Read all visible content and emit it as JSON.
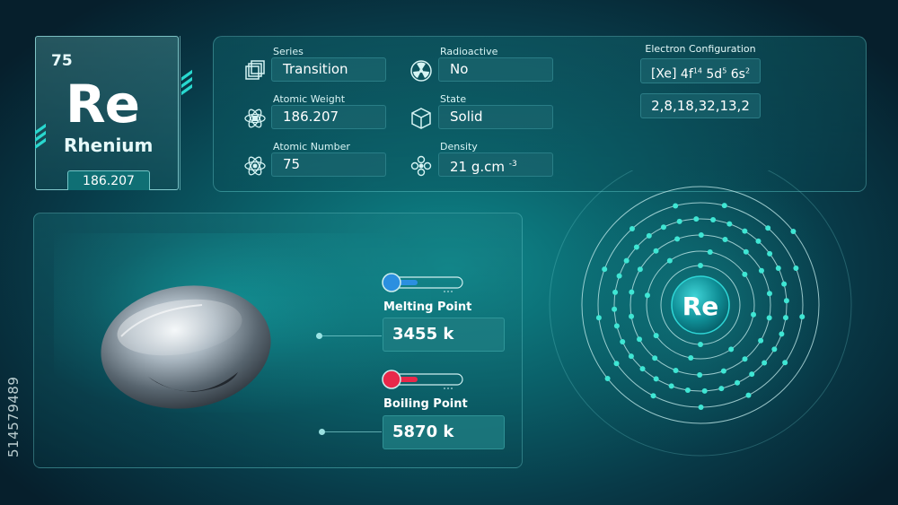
{
  "watermark": "514579489",
  "element": {
    "atomic_number": "75",
    "symbol": "Re",
    "name": "Rhenium",
    "atomic_weight": "186.207"
  },
  "properties": {
    "series_label": "Series",
    "series_value": "Transition",
    "radioactive_label": "Radioactive",
    "radioactive_value": "No",
    "atomic_weight_label": "Atomic Weight",
    "atomic_weight_value": "186.207",
    "state_label": "State",
    "state_value": "Solid",
    "atomic_number_label": "Atomic Number",
    "atomic_number_value": "75",
    "density_label": "Density",
    "density_value": "21 g.cm",
    "density_exp": "-3"
  },
  "electron_configuration": {
    "label": "Electron Configuration",
    "core": "[Xe]",
    "orbitals": [
      {
        "orbital": "4f",
        "count": "14"
      },
      {
        "orbital": "5d",
        "count": "5"
      },
      {
        "orbital": "6s",
        "count": "2"
      }
    ],
    "shells": "2,8,18,32,13,2",
    "shell_counts": [
      2,
      8,
      18,
      32,
      13,
      2
    ]
  },
  "physical": {
    "melting_label": "Melting Point",
    "melting_value": "3455 k",
    "boiling_label": "Boiling Point",
    "boiling_value": "5870 k",
    "melting_color": "#2b8fe0",
    "boiling_color": "#e8284a"
  },
  "atom": {
    "nucleus_symbol": "Re",
    "electron_color": "#3fe6d4"
  },
  "colors": {
    "accent": "#29d8cf",
    "background": "#0a5f68"
  }
}
